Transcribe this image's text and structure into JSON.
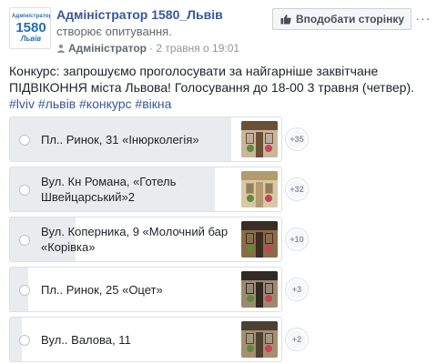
{
  "page": {
    "avatar": {
      "line1": "Адміністратор",
      "line2": "1580",
      "line3": "Львів"
    },
    "name": "Адміністратор 1580_Львів",
    "action": "створює опитування.",
    "author": "Адміністратор",
    "timestamp": "· 2 травня о 19:01",
    "like_button": "Вподобати сторінку",
    "more": "···"
  },
  "post": {
    "line1": "Конкурс: запрошуємо проголосувати за найгарніше заквітчане",
    "line2": "ПІДВІКОННЯ міста Львова! Голосування до 18-00 3 травня (четвер).",
    "hashtags": "#lviv #львів #конкурс #вікна"
  },
  "poll": {
    "options": [
      {
        "label": "Пл.. Ринок, 31 «Інюрколегія»",
        "votes": "+35",
        "share": 0.95,
        "thumb_colors": [
          "#6b4f36",
          "#c9b79a",
          "#f2ece1"
        ]
      },
      {
        "label": "Вул. Кн Романа, «Готель Швейцарський»2",
        "votes": "+32",
        "share": 0.88,
        "thumb_colors": [
          "#b49a6f",
          "#d8c8a4",
          "#7a6a4a"
        ]
      },
      {
        "label": "Вул. Коперника, 9 «Молочний бар «Корівка»",
        "votes": "+10",
        "share": 0.28,
        "thumb_colors": [
          "#3a2e24",
          "#8c6b48",
          "#c49a68"
        ]
      },
      {
        "label": "Пл.. Ринок, 25 «Оцет»",
        "votes": "+3",
        "share": 0.08,
        "thumb_colors": [
          "#2f2a24",
          "#9d8a6d",
          "#d9c9ad"
        ]
      },
      {
        "label": "Вул.. Валова, 11",
        "votes": "+2",
        "share": 0.05,
        "thumb_colors": [
          "#4c4034",
          "#a68e6e",
          "#e0d4bd"
        ]
      }
    ]
  }
}
